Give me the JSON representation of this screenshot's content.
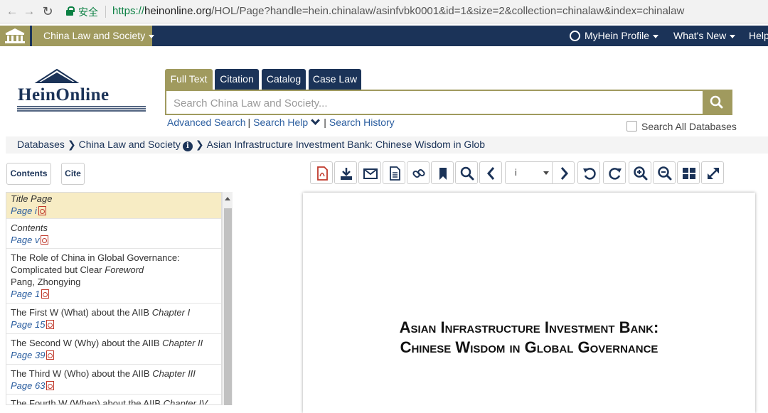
{
  "browser": {
    "secure_label": "安全",
    "url_scheme": "https://",
    "url_host": "heinonline.org",
    "url_path": "/HOL/Page?handle=hein.chinalaw/asinfvbk0001&id=1&size=2&collection=chinalaw&index=chinalaw"
  },
  "topnav": {
    "collection_label": "China Law and Society",
    "profile_label": "MyHein Profile",
    "whats_new_label": "What's New",
    "help_label": "Help"
  },
  "logo": {
    "text": "HeinOnline"
  },
  "search": {
    "tabs": [
      "Full Text",
      "Citation",
      "Catalog",
      "Case Law"
    ],
    "placeholder": "Search China Law and Society...",
    "advanced_label": "Advanced Search",
    "help_label": "Search Help",
    "history_label": "Search History",
    "all_databases_label": "Search All Databases"
  },
  "breadcrumb": {
    "databases": "Databases",
    "collection": "China Law and Society",
    "title": "Asian Infrastructure Investment Bank: Chinese Wisdom in Glob"
  },
  "left_buttons": {
    "contents": "Contents",
    "cite": "Cite"
  },
  "toc": [
    {
      "title": "",
      "title_italic": "Title Page",
      "author": "",
      "page": "Page i"
    },
    {
      "title": "",
      "title_italic": "Contents",
      "author": "",
      "page": "Page v"
    },
    {
      "title": "The Role of China in Global Governance: Complicated but Clear",
      "title_italic": "Foreword",
      "author": "Pang, Zhongying",
      "page": "Page 1"
    },
    {
      "title": "The First W (What) about the AIIB",
      "title_italic": "Chapter I",
      "author": "",
      "page": "Page 15"
    },
    {
      "title": "The Second W (Why) about the AIIB",
      "title_italic": "Chapter II",
      "author": "",
      "page": "Page 39"
    },
    {
      "title": "The Third W (Who) about the AIIB",
      "title_italic": "Chapter III",
      "author": "",
      "page": "Page 63"
    },
    {
      "title": "The Fourth W (When) about the AIIB",
      "title_italic": "Chapter IV",
      "author": "",
      "page": ""
    }
  ],
  "viewer": {
    "page_select_value": "i",
    "tool_icons": [
      "pdf-icon",
      "download-icon",
      "email-icon",
      "text-icon",
      "link-icon",
      "bookmark-icon",
      "search-icon",
      "chevron-left-icon",
      "chevron-right-icon",
      "rotate-left-icon",
      "rotate-right-icon",
      "zoom-in-icon",
      "zoom-out-icon",
      "grid-icon",
      "expand-icon"
    ]
  },
  "document": {
    "title_line1": "Asian Infrastructure Investment Bank:",
    "title_line2": "Chinese Wisdom in Global Governance"
  },
  "colors": {
    "navy": "#1b3358",
    "gold": "#a09a5e",
    "link": "#2a5d9f",
    "pdf_red": "#c0392b",
    "secure_green": "#0b8043"
  }
}
